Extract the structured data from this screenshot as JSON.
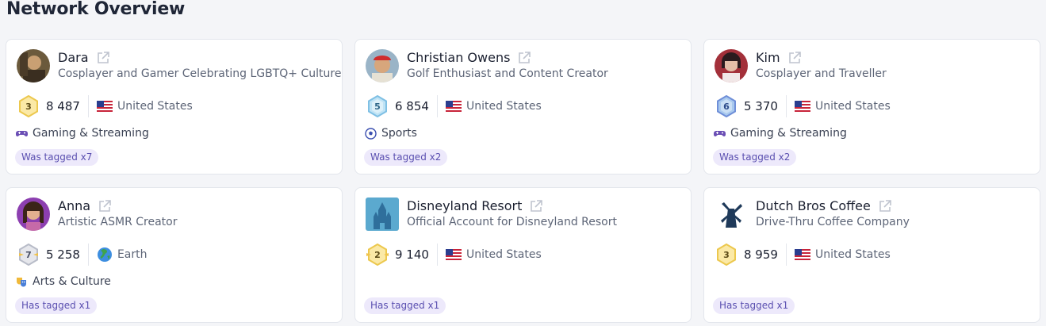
{
  "page": {
    "title": "Network Overview"
  },
  "profiles": [
    {
      "name": "Dara",
      "subtitle": "Cosplayer and Gamer Celebrating LGBTQ+ Culture",
      "level": "3",
      "followers": "8 487",
      "country": "United States",
      "category": "Gaming & Streaming",
      "tag": "Was tagged x7"
    },
    {
      "name": "Christian Owens",
      "subtitle": "Golf Enthusiast and Content Creator",
      "level": "5",
      "followers": "6 854",
      "country": "United States",
      "category": "Sports",
      "tag": "Was tagged x2"
    },
    {
      "name": "Kim",
      "subtitle": "Cosplayer and Traveller",
      "level": "6",
      "followers": "5 370",
      "country": "United States",
      "category": "Gaming & Streaming",
      "tag": "Was tagged x2"
    },
    {
      "name": "Anna",
      "subtitle": "Artistic ASMR Creator",
      "level": "7",
      "followers": "5 258",
      "country": "Earth",
      "category": "Arts & Culture",
      "tag": "Has tagged x1"
    },
    {
      "name": "Disneyland Resort",
      "subtitle": "Official Account for Disneyland Resort",
      "level": "2",
      "followers": "9 140",
      "country": "United States",
      "category": "",
      "tag": "Has tagged x1"
    },
    {
      "name": "Dutch Bros Coffee",
      "subtitle": "Drive-Thru Coffee Company",
      "level": "3",
      "followers": "8 959",
      "country": "United States",
      "category": "",
      "tag": "Has tagged x1"
    }
  ],
  "icons": {
    "external_link": "external-link-icon",
    "flag_us": "us-flag-icon",
    "globe": "globe-icon",
    "gaming": "gamepad-icon",
    "sports": "soccer-ball-icon",
    "arts": "theater-masks-icon"
  },
  "colors": {
    "tag_pill_bg": "#ede9fb",
    "tag_pill_text": "#5a4fb0",
    "badge_gold": "#f3d774",
    "badge_blue": "#8fc6e8"
  }
}
